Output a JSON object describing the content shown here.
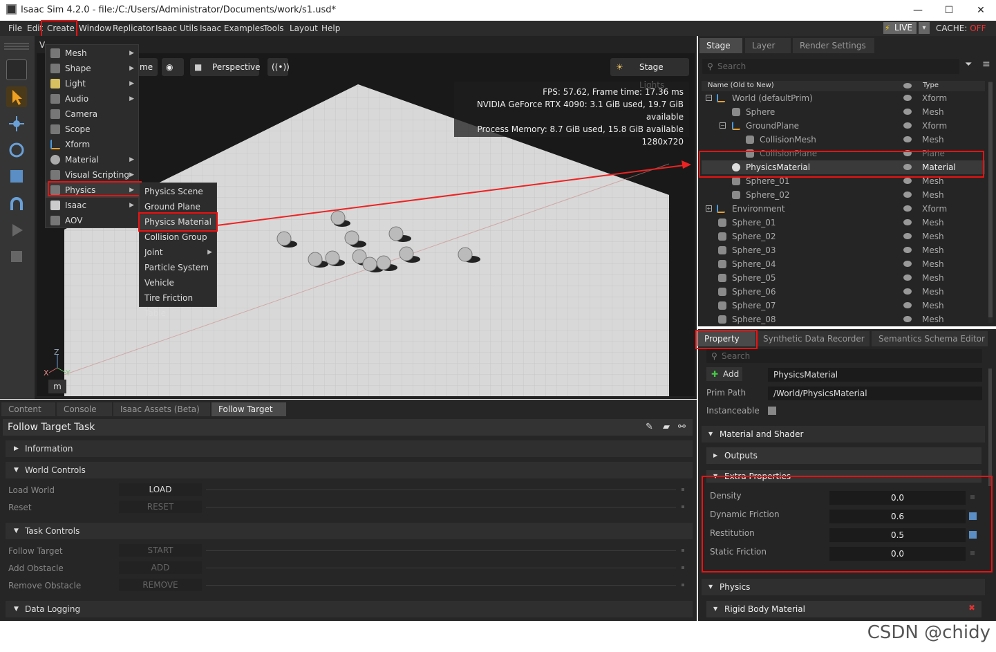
{
  "window": {
    "title": "Isaac Sim 4.2.0 - file:/C:/Users/Administrator/Documents/work/s1.usd*",
    "minimize": "—",
    "maximize": "☐",
    "close": "✕"
  },
  "menubar": {
    "items": [
      "File",
      "Edit",
      "Create",
      "Window",
      "Replicator",
      "Isaac Utils",
      "Isaac Examples",
      "Tools",
      "Layout",
      "Help"
    ],
    "live": "LIVE",
    "cache_label": "CACHE:",
    "cache_value": "OFF"
  },
  "create_menu": {
    "items": [
      {
        "label": "Mesh",
        "icon": "mesh-icon",
        "submenu": true
      },
      {
        "label": "Shape",
        "icon": "shape-icon",
        "submenu": true
      },
      {
        "label": "Light",
        "icon": "light-icon",
        "submenu": true
      },
      {
        "label": "Audio",
        "icon": "audio-icon",
        "submenu": true
      },
      {
        "label": "Camera",
        "icon": "camera-icon",
        "submenu": false
      },
      {
        "label": "Scope",
        "icon": "folder-icon",
        "submenu": false
      },
      {
        "label": "Xform",
        "icon": "xform-icon",
        "submenu": false
      },
      {
        "label": "Material",
        "icon": "material-icon",
        "submenu": true
      },
      {
        "label": "Visual Scripting",
        "icon": "visual-scripting-icon",
        "submenu": true
      },
      {
        "label": "Physics",
        "icon": "physics-icon",
        "submenu": true
      },
      {
        "label": "Isaac",
        "icon": "isaac-icon",
        "submenu": true
      },
      {
        "label": "AOV",
        "icon": "aov-icon",
        "submenu": false
      }
    ]
  },
  "physics_submenu": {
    "items": [
      {
        "label": "Physics Scene",
        "submenu": false
      },
      {
        "label": "Ground Plane",
        "submenu": false
      },
      {
        "label": "Physics Material",
        "submenu": false
      },
      {
        "label": "Collision Group",
        "submenu": false
      },
      {
        "label": "Joint",
        "submenu": true
      },
      {
        "label": "Particle System",
        "submenu": false
      },
      {
        "label": "Vehicle",
        "submenu": false
      },
      {
        "label": "Tire Friction Table",
        "submenu": false
      }
    ]
  },
  "viewport": {
    "tab_fragment": "V",
    "cam_fragment": "me",
    "perspective": "Perspective",
    "stage_lights": "Stage Lights",
    "stats": [
      "FPS: 57.62, Frame time: 17.36 ms",
      "NVIDIA GeForce RTX 4090: 3.1 GiB used, 19.7 GiB available",
      "Process Memory: 8.7 GiB used, 15.8 GiB available",
      "1280x720"
    ],
    "unit": "m",
    "axis_z": "Z",
    "axis_x": "X",
    "axis_y": "Y"
  },
  "stage": {
    "tabs": [
      "Stage",
      "Layer",
      "Render Settings"
    ],
    "search_placeholder": "Search",
    "col_name": "Name (Old to New)",
    "col_type": "Type",
    "rows": [
      {
        "name": "World (defaultPrim)",
        "type": "Xform",
        "icon": "xform-icon",
        "toggle": "−"
      },
      {
        "name": "Sphere",
        "type": "Mesh",
        "icon": "mesh-icon",
        "toggle": ""
      },
      {
        "name": "GroundPlane",
        "type": "Xform",
        "icon": "xform-icon",
        "toggle": "−"
      },
      {
        "name": "CollisionMesh",
        "type": "Mesh",
        "icon": "mesh-icon",
        "toggle": ""
      },
      {
        "name": "CollisionPlane",
        "type": "Plane",
        "icon": "mesh-icon",
        "toggle": ""
      },
      {
        "name": "PhysicsMaterial",
        "type": "Material",
        "icon": "material-icon",
        "toggle": ""
      },
      {
        "name": "Sphere_01",
        "type": "Mesh",
        "icon": "mesh-icon",
        "toggle": ""
      },
      {
        "name": "Sphere_02",
        "type": "Mesh",
        "icon": "mesh-icon",
        "toggle": ""
      },
      {
        "name": "Environment",
        "type": "Xform",
        "icon": "xform-icon",
        "toggle": "+"
      },
      {
        "name": "Sphere_01",
        "type": "Mesh",
        "icon": "mesh-icon",
        "toggle": ""
      },
      {
        "name": "Sphere_02",
        "type": "Mesh",
        "icon": "mesh-icon",
        "toggle": ""
      },
      {
        "name": "Sphere_03",
        "type": "Mesh",
        "icon": "mesh-icon",
        "toggle": ""
      },
      {
        "name": "Sphere_04",
        "type": "Mesh",
        "icon": "mesh-icon",
        "toggle": ""
      },
      {
        "name": "Sphere_05",
        "type": "Mesh",
        "icon": "mesh-icon",
        "toggle": ""
      },
      {
        "name": "Sphere_06",
        "type": "Mesh",
        "icon": "mesh-icon",
        "toggle": ""
      },
      {
        "name": "Sphere_07",
        "type": "Mesh",
        "icon": "mesh-icon",
        "toggle": ""
      },
      {
        "name": "Sphere_08",
        "type": "Mesh",
        "icon": "mesh-icon",
        "toggle": ""
      }
    ]
  },
  "property": {
    "tabs": [
      "Property",
      "Synthetic Data Recorder",
      "Semantics Schema Editor"
    ],
    "search_placeholder": "Search",
    "add_label": "Add",
    "prim_name": "PhysicsMaterial",
    "prim_path_label": "Prim Path",
    "prim_path": "/World/PhysicsMaterial",
    "instanceable_label": "Instanceable",
    "sections": {
      "material_shader": "Material and Shader",
      "outputs": "Outputs",
      "extra": "Extra Properties",
      "physics": "Physics",
      "rigid": "Rigid Body Material"
    },
    "props": [
      {
        "label": "Density",
        "value": "0.0"
      },
      {
        "label": "Dynamic Friction",
        "value": "0.6"
      },
      {
        "label": "Restitution",
        "value": "0.5"
      },
      {
        "label": "Static Friction",
        "value": "0.0"
      }
    ]
  },
  "bottom": {
    "tabs": [
      "Content",
      "Console",
      "Isaac Assets (Beta)",
      "Follow Target"
    ],
    "title": "Follow Target Task",
    "sections": {
      "info": "Information",
      "world": "World Controls",
      "task": "Task Controls",
      "logging": "Data Logging"
    },
    "world_rows": [
      {
        "label": "Load World",
        "button": "LOAD"
      },
      {
        "label": "Reset",
        "button": "RESET"
      }
    ],
    "task_rows": [
      {
        "label": "Follow Target",
        "button": "START"
      },
      {
        "label": "Add Obstacle",
        "button": "ADD"
      },
      {
        "label": "Remove Obstacle",
        "button": "REMOVE"
      }
    ]
  },
  "watermark": "CSDN @chidy"
}
